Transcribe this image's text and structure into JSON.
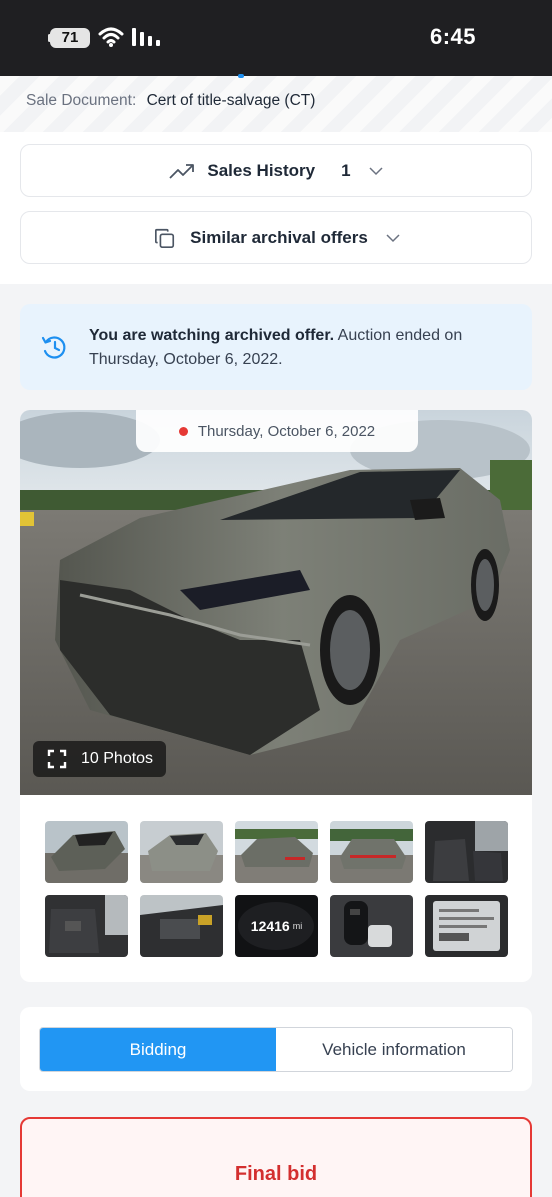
{
  "status_bar": {
    "battery": "71",
    "time": "6:45"
  },
  "sale_document": {
    "label": "Sale Document:",
    "value": "Cert of title-salvage (CT)"
  },
  "sales_history": {
    "label": "Sales History",
    "count": "1",
    "icon": "trend-up-icon"
  },
  "similar_offers": {
    "label": "Similar archival offers",
    "icon": "copy-icon"
  },
  "archive_notice": {
    "bold": "You are watching archived offer.",
    "text": "Auction ended on Thursday, October 6, 2022.",
    "icon": "history-icon"
  },
  "photo": {
    "date": "Thursday, October 6, 2022",
    "photos_label": "10 Photos"
  },
  "thumbnails": [
    {
      "name": "front-left"
    },
    {
      "name": "front-right"
    },
    {
      "name": "rear-left"
    },
    {
      "name": "rear"
    },
    {
      "name": "interior-front"
    },
    {
      "name": "interior-rear"
    },
    {
      "name": "engine"
    },
    {
      "name": "odometer",
      "mileage": "12416",
      "unit": "mi"
    },
    {
      "name": "key"
    },
    {
      "name": "label"
    }
  ],
  "tabs": {
    "bidding": "Bidding",
    "vehicle_info": "Vehicle information"
  },
  "final_bid": {
    "label": "Final bid"
  },
  "colors": {
    "accent": "#2196f3",
    "danger": "#e53935",
    "banner": "#e8f3fd"
  }
}
